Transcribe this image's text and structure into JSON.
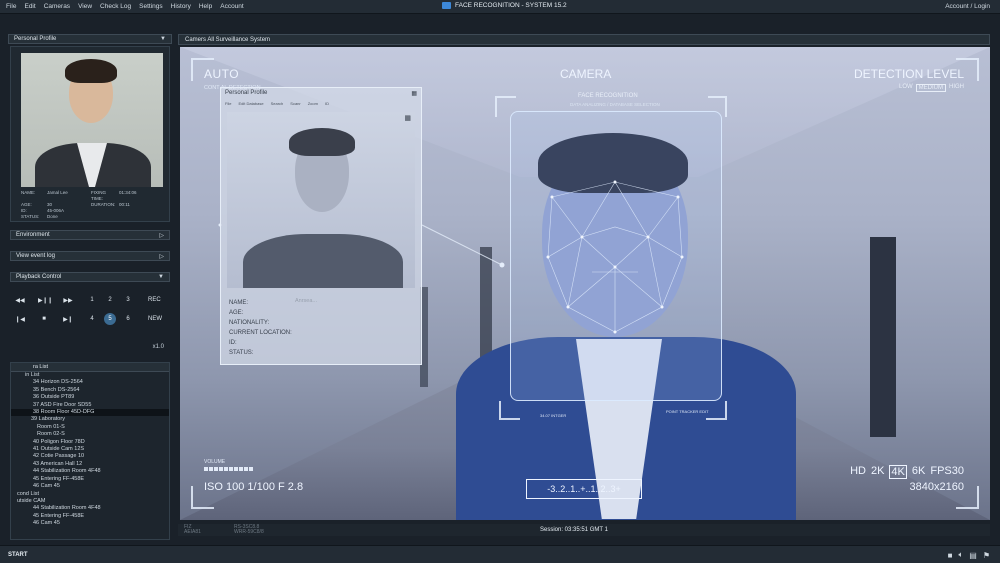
{
  "menu": {
    "items": [
      "File",
      "Edit",
      "Cameras",
      "View",
      "Check Log",
      "Settings",
      "History",
      "Help",
      "Account"
    ],
    "app_title": "FACE RECOGNITION  -  SYSTEM 15.2",
    "account_login": "Account / Login"
  },
  "left": {
    "profile_header": "Personal Profile",
    "profile": {
      "name_label": "NAME:",
      "name": "Jamal Lee",
      "fixing_label": "FIXING TIME:",
      "fixing": "01:34:06",
      "age_label": "AGE:",
      "age": "30",
      "duration_label": "DURATION:",
      "duration": "00:11",
      "id_label": "ID:",
      "id": "45-006A",
      "status_label": "STATUS:",
      "status": "Done"
    },
    "environment": "Environment",
    "view_event_log": "View event log",
    "playback_header": "Playback Control",
    "playback": {
      "row1_nums": [
        "1",
        "2",
        "3"
      ],
      "row1_action": "REC",
      "row2_nums": [
        "4",
        "5",
        "6"
      ],
      "row2_action": "NEW",
      "active_num": "5",
      "speed": "x1.0"
    },
    "camera_list_header": "ra List",
    "camera_list": [
      "in List",
      "34 Horizon DS-2564",
      "35 Bench DS-2564",
      "36 Outside PT89",
      "37 ASD Fire Door SD55",
      "38 Room Floor 45D-DFG",
      "39 Laboratory",
      "Room 01-S",
      "Room 02-S",
      "40 Poligon Floor 78D",
      "41 Outside Cam 12S",
      "42 Cotie Passage 10",
      "43 American Hall 12",
      "44 Stabilization Room 4F48",
      "45 Entering FF-458E",
      "46 Cam 45",
      "cond List",
      "utside CAM",
      "44 Stabilization Room 4F48",
      "45 Entering FF-458E",
      "46 Cam 45"
    ],
    "selected_camera_index": 5
  },
  "main": {
    "header": "Camers All Surveillance System",
    "hud": {
      "auto": "AUTO",
      "auto_sub": "CONT                    AL DETECTION",
      "camera": "CAMERA",
      "detection": "DETECTION LEVEL",
      "levels": [
        "LOW",
        "MEDIUM",
        "HIGH"
      ],
      "active_level": "MEDIUM",
      "fr_title": "FACE RECOGNITION",
      "fr_sub": "DATA ANALIZING / DATABASE SELECTION",
      "volume": "VOLUME",
      "iso": "ISO 100 1/100 F 2.8",
      "resolutions": [
        "HD",
        "2K",
        "4K",
        "6K",
        "FPS30"
      ],
      "active_res": "4K",
      "dimensions": "3840x2160",
      "scale": "-3..2..1..+..1..2..3+",
      "face_label_left": "34.07 INTGER",
      "face_label_right": "POINT TRACKER EDIT"
    },
    "mini_window": {
      "title": "Personal Profile",
      "menu": [
        "File",
        "Edit Database",
        "Search",
        "Scanr",
        "Zoom",
        "ID"
      ],
      "fields": [
        "NAME:",
        "AGE:",
        "NATIONALITY:",
        "CURRENT LOCATION:",
        "ID:",
        "STATUS:"
      ],
      "ghost": "Anrsea..."
    },
    "bottom": {
      "code_left": [
        "FIZ",
        "AEIA81"
      ],
      "code_right": [
        "RS-3SC8.8",
        "WRR-59C8/8"
      ],
      "session": "Session: 03:35:51 GMT 1"
    }
  },
  "taskbar": {
    "start": "START",
    "tray_icons": [
      "camera-icon",
      "volume-icon",
      "network-icon",
      "flag-icon"
    ]
  },
  "colors": {
    "accent": "#3b6b92",
    "app_logo": "#3d88d8",
    "panel_bg": "#263038"
  }
}
